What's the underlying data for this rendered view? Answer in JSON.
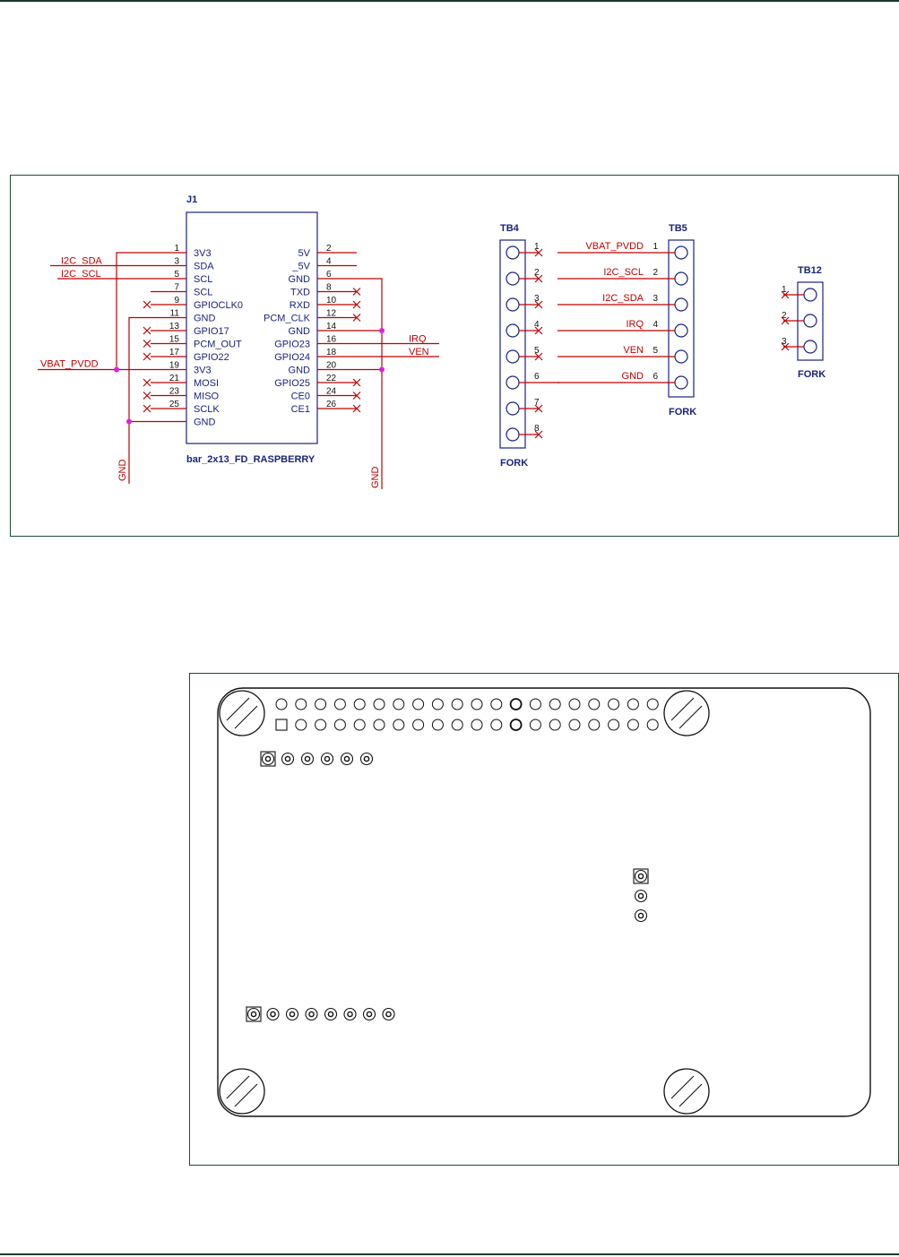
{
  "colors": {
    "frame": "#1f4a33",
    "rule": "#173d2a",
    "wire": "#c00000",
    "label_red": "#c00000",
    "label_blue": "#1a237e",
    "body_blue": "#1a237e",
    "junction": "#e020e0",
    "pcb_outline": "#111111"
  },
  "schematic": {
    "j1": {
      "ref": "J1",
      "part": "bar_2x13_FD_RASPBERRY",
      "left_pins": [
        {
          "num": "1",
          "name": "3V3",
          "net": ""
        },
        {
          "num": "3",
          "name": "SDA",
          "net": "I2C_SDA"
        },
        {
          "num": "5",
          "name": "SCL",
          "net": "I2C_SCL"
        },
        {
          "num": "7",
          "name": "SCL",
          "net": ""
        },
        {
          "num": "9",
          "name": "GPIOCLK0",
          "net": ""
        },
        {
          "num": "11",
          "name": "GND",
          "net": ""
        },
        {
          "num": "13",
          "name": "GPIO17",
          "net": ""
        },
        {
          "num": "15",
          "name": "PCM_OUT",
          "net": ""
        },
        {
          "num": "17",
          "name": "GPIO22",
          "net": ""
        },
        {
          "num": "19",
          "name": "3V3",
          "net": "VBAT_PVDD"
        },
        {
          "num": "21",
          "name": "MOSI",
          "net": ""
        },
        {
          "num": "23",
          "name": "MISO",
          "net": ""
        },
        {
          "num": "25",
          "name": "SCLK",
          "net": ""
        },
        {
          "num": "",
          "name": "GND",
          "net": ""
        }
      ],
      "right_pins": [
        {
          "num": "2",
          "name": "5V",
          "net": ""
        },
        {
          "num": "4",
          "name": "_5V",
          "net": ""
        },
        {
          "num": "6",
          "name": "GND",
          "net": ""
        },
        {
          "num": "8",
          "name": "TXD",
          "net": ""
        },
        {
          "num": "10",
          "name": "RXD",
          "net": ""
        },
        {
          "num": "12",
          "name": "PCM_CLK",
          "net": ""
        },
        {
          "num": "14",
          "name": "GND",
          "net": ""
        },
        {
          "num": "16",
          "name": "GPIO23",
          "net": "IRQ"
        },
        {
          "num": "18",
          "name": "GPIO24",
          "net": "VEN"
        },
        {
          "num": "20",
          "name": "GND",
          "net": ""
        },
        {
          "num": "22",
          "name": "GPIO25",
          "net": ""
        },
        {
          "num": "24",
          "name": "CE0",
          "net": ""
        },
        {
          "num": "26",
          "name": "CE1",
          "net": ""
        }
      ],
      "gnd_left": "GND",
      "gnd_right": "GND"
    },
    "tb4": {
      "ref": "TB4",
      "type": "FORK",
      "pins": [
        "1",
        "2",
        "3",
        "4",
        "5",
        "6",
        "7",
        "8"
      ]
    },
    "tb5": {
      "ref": "TB5",
      "type": "FORK",
      "pins": [
        {
          "num": "1",
          "net": "VBAT_PVDD"
        },
        {
          "num": "2",
          "net": "I2C_SCL"
        },
        {
          "num": "3",
          "net": "I2C_SDA"
        },
        {
          "num": "4",
          "net": "IRQ"
        },
        {
          "num": "5",
          "net": "VEN"
        },
        {
          "num": "6",
          "net": "GND"
        }
      ]
    },
    "tb12": {
      "ref": "TB12",
      "type": "FORK",
      "pins": [
        "1",
        "2",
        "3"
      ]
    }
  },
  "pcb": {
    "header_columns": 20,
    "header_rows": 2,
    "connector_top_pins": 6,
    "connector_mid_pins": 3,
    "connector_bottom_pins": 8,
    "mounting_holes": 4
  }
}
